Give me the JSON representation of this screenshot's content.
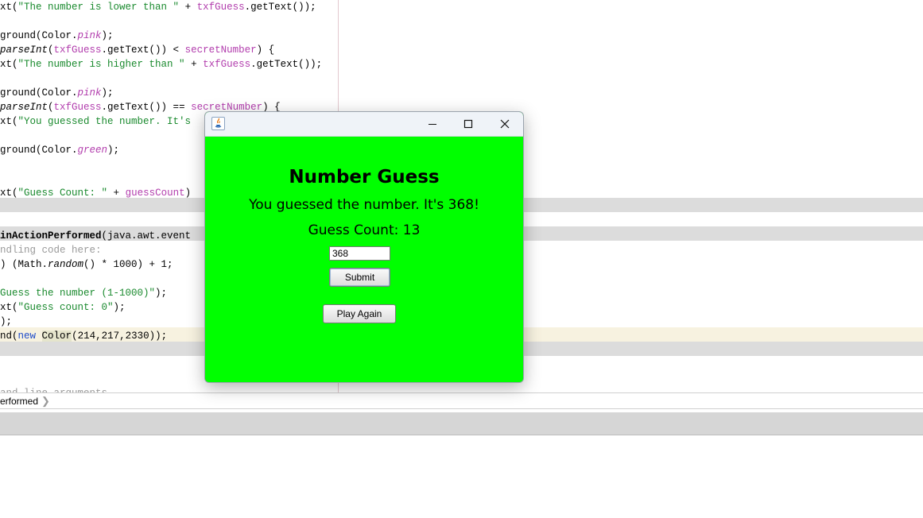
{
  "editor": {
    "lines": [
      [
        "xt(",
        {
          "s": "\"The number is lower than \""
        },
        " + ",
        {
          "f": "txfGuess"
        },
        ".getText());"
      ],
      [],
      [
        "ground(Color.",
        {
          "fi": "pink"
        },
        ");"
      ],
      [
        {
          "i": "parseInt"
        },
        "(",
        {
          "f": "txfGuess"
        },
        ".getText()) < ",
        {
          "f": "secretNumber"
        },
        ") {"
      ],
      [
        "xt(",
        {
          "s": "\"The number is higher than \""
        },
        " + ",
        {
          "f": "txfGuess"
        },
        ".getText());"
      ],
      [],
      [
        "ground(Color.",
        {
          "fi": "pink"
        },
        ");"
      ],
      [
        {
          "i": "parseInt"
        },
        "(",
        {
          "f": "txfGuess"
        },
        ".getText()) == ",
        {
          "f": "secretNumber"
        },
        ") {"
      ],
      [
        "xt(",
        {
          "s": "\"You guessed the number. It's"
        }
      ],
      [],
      [
        "ground(Color.",
        {
          "fi": "green"
        },
        ");"
      ],
      [],
      [],
      [
        "xt(",
        {
          "s": "\"Guess Count: \""
        },
        " + ",
        {
          "f": "guessCount"
        },
        ")"
      ],
      [],
      [],
      [
        {
          "b": "inActionPerformed"
        },
        "(java.awt.event"
      ],
      [
        {
          "c": "ndling code here:"
        }
      ],
      [
        ") (Math.",
        {
          "i": "random"
        },
        "() * 1000) + 1;"
      ],
      [],
      [
        {
          "s": "Guess the number (1-1000)\""
        },
        ");"
      ],
      [
        "xt(",
        {
          "s": "\"Guess count: 0\""
        },
        ");"
      ],
      [
        ");"
      ],
      [
        "nd(",
        {
          "k": "new"
        },
        " ",
        {
          "h": "Color"
        },
        "(214,217,2330));"
      ],
      [],
      [],
      [],
      [
        {
          "c": "and line arguments"
        }
      ]
    ],
    "breadcrumb": "erformed"
  },
  "window": {
    "title": "",
    "controls": {
      "minimize": "minimize-icon",
      "maximize": "maximize-icon",
      "close": "close-icon"
    },
    "background": "#00ff00",
    "heading": "Number Guess",
    "message": "You guessed the number. It's 368!",
    "guess_count": "Guess Count: 13",
    "guess_value": "368",
    "submit_label": "Submit",
    "play_again_label": "Play Again"
  }
}
